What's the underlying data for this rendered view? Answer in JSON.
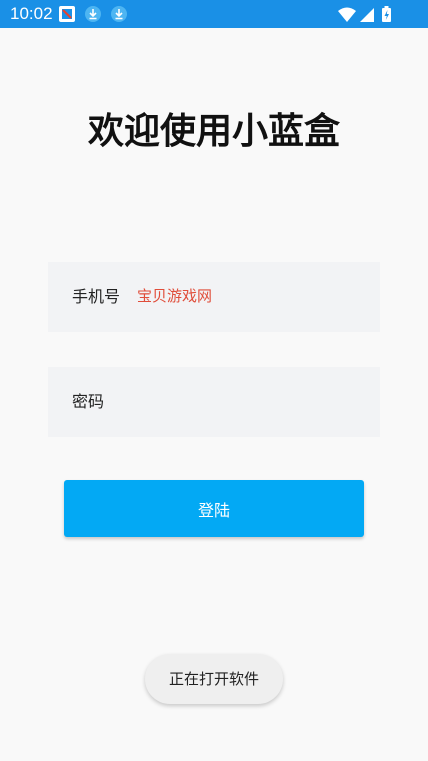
{
  "status_bar": {
    "time": "10:02",
    "colors": {
      "background": "#1a90e6"
    },
    "icons": [
      "app-notification-icon",
      "download-icon",
      "download-icon",
      "wifi-icon",
      "signal-icon",
      "battery-charging-icon"
    ]
  },
  "title": "欢迎使用小蓝盒",
  "form": {
    "phone": {
      "label": "手机号",
      "value": "",
      "placeholder": ""
    },
    "password": {
      "label": "密码",
      "value": "",
      "placeholder": ""
    },
    "login_label": "登陆"
  },
  "watermark": "宝贝游戏网",
  "toast": "正在打开软件",
  "colors": {
    "accent": "#03a9f4",
    "field_background": "#f2f3f5",
    "watermark": "#e04d3a"
  }
}
